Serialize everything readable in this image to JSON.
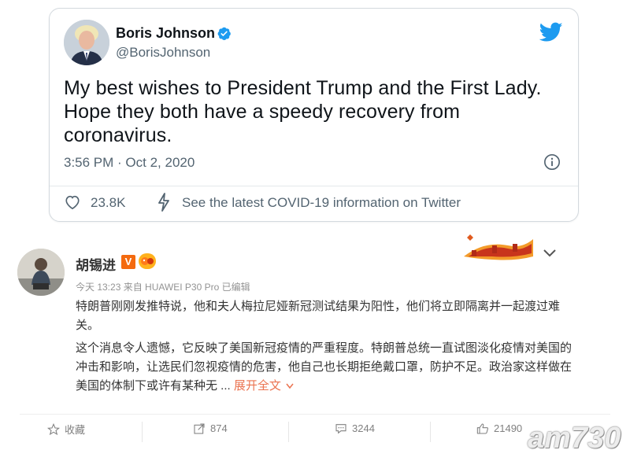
{
  "tweet": {
    "name": "Boris Johnson",
    "handle": "@BorisJohnson",
    "text": "My best wishes to President Trump and the First Lady. Hope they both have a speedy recovery from coronavirus.",
    "timestamp": "3:56 PM · Oct 2, 2020",
    "likes": "23.8K",
    "covid_link": "See the latest COVID-19 information on Twitter",
    "icons": [
      "verified-icon",
      "twitter-bird-icon",
      "info-icon",
      "heart-icon",
      "bolt-icon"
    ],
    "colors": {
      "verified": "#1d9bf0",
      "bird": "#1d9bf0",
      "text": "#0f1419",
      "muted": "#536471"
    }
  },
  "weibo": {
    "name": "胡锡进",
    "vip_badge": "V",
    "meta": "今天 13:23 来自 HUAWEI P30 Pro   已编辑",
    "para1": "特朗普刚刚发推特说，他和夫人梅拉尼娅新冠测试结果为阳性，他们将立即隔离并一起渡过难关。",
    "para2": "这个消息令人遗憾，它反映了美国新冠疫情的严重程度。特朗普总统一直试图淡化疫情对美国的冲击和影响，让选民们忽视疫情的危害，他自己也长期拒绝戴口罩，防护不足。政治家这样做在美国的体制下或许有某种无 ...",
    "expand_label": "展开全文",
    "actions": {
      "favorite": "收藏",
      "repost": "874",
      "comment": "3244",
      "like": "21490"
    },
    "icons": [
      "star-icon",
      "repost-icon",
      "comment-icon",
      "thumbs-up-icon",
      "chevron-down-icon",
      "great-wall-decoration"
    ],
    "colors": {
      "expand": "#eb7350",
      "vip": "#f46a0f",
      "muted": "#939393"
    }
  },
  "watermark": "am730"
}
